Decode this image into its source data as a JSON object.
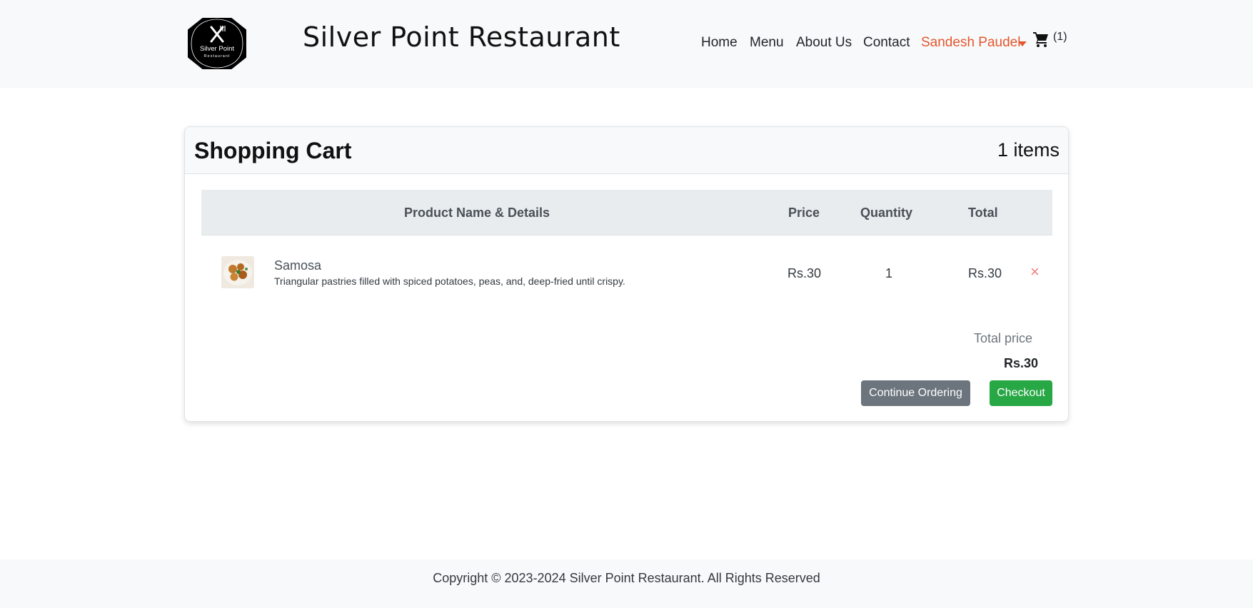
{
  "header": {
    "logo_text_line1": "Silver Point",
    "logo_text_line2": "Restaurant",
    "brand": "Silver Point Restaurant",
    "nav": {
      "home": "Home",
      "menu": "Menu",
      "about": "About Us",
      "contact": "Contact",
      "user": "Sandesh Paudel"
    },
    "cart_count": "(1)"
  },
  "cart": {
    "title": "Shopping Cart",
    "item_count": "1 items",
    "columns": {
      "product": "Product Name & Details",
      "price": "Price",
      "quantity": "Quantity",
      "total": "Total"
    },
    "items": [
      {
        "name": "Samosa",
        "description": "Triangular pastries filled with spiced potatoes, peas, and, deep-fried until crispy.",
        "price": "Rs.30",
        "quantity": "1",
        "total": "Rs.30",
        "remove_icon": "×"
      }
    ],
    "total_label": "Total price",
    "total_value": "Rs.30",
    "continue_button": "Continue Ordering",
    "checkout_button": "Checkout"
  },
  "footer": {
    "copyright": "Copyright © 2023-2024 Silver Point Restaurant. All Rights Reserved"
  },
  "colors": {
    "accent_user": "#e4572e",
    "checkout": "#28a745",
    "continue": "#6c757d",
    "remove": "#f08080"
  },
  "icons": [
    "logo-icon",
    "caret-down-icon",
    "shopping-cart-icon",
    "close-icon"
  ]
}
